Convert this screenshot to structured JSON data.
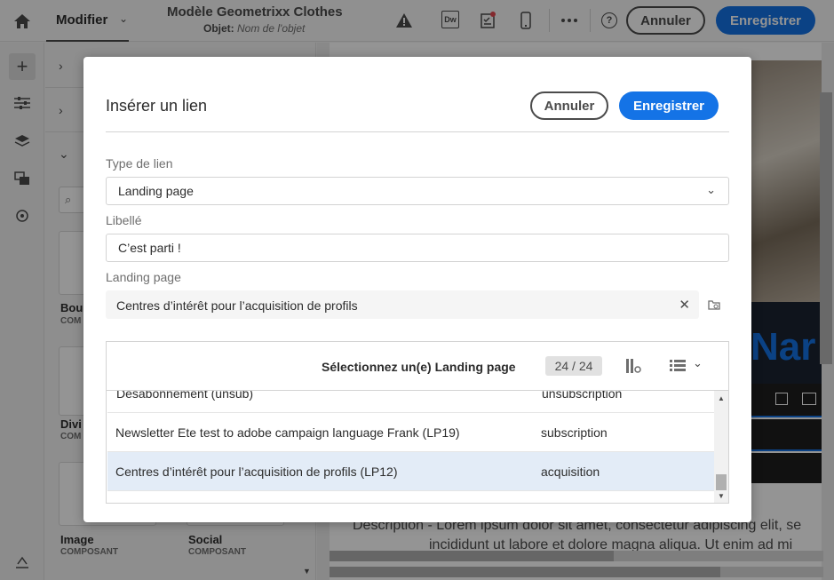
{
  "topbar": {
    "mode_label": "Modifier",
    "template_title": "Modèle Geometrixx Clothes",
    "subject_label": "Objet:",
    "subject_placeholder": "Nom de l'objet",
    "dw_icon_text": "Dw",
    "cancel_label": "Annuler",
    "save_label": "Enregistrer"
  },
  "left_panel": {
    "items": [
      {
        "title": "Bou",
        "sub": "COM"
      },
      {
        "title": "Divi",
        "sub": "COM"
      },
      {
        "title": "Image",
        "sub": "COMPOSANT"
      },
      {
        "title": "Social",
        "sub": "COMPOSANT"
      }
    ]
  },
  "canvas": {
    "title_fragment": "Nar",
    "description": "Description - Lorem ipsum dolor sit amet, consectetur adipiscing elit, se",
    "description_line2": "incididunt ut labore et dolore magna aliqua. Ut enim ad mi"
  },
  "dialog": {
    "title": "Insérer un lien",
    "cancel_label": "Annuler",
    "save_label": "Enregistrer",
    "link_type_label": "Type de lien",
    "link_type_value": "Landing page",
    "libelle_label": "Libellé",
    "libelle_value": "C’est parti !",
    "landing_label": "Landing page",
    "landing_value": "Centres d’intérêt pour l’acquisition de profils",
    "picker": {
      "title": "Sélectionnez un(e) Landing page",
      "count": "24 / 24",
      "rows": [
        {
          "name": "Désabonnement (unsub)",
          "type": "unsubscription"
        },
        {
          "name": "Newsletter Ete test to adobe campaign language Frank (LP19)",
          "type": "subscription"
        },
        {
          "name": "Centres d’intérêt pour l’acquisition de profils (LP12)",
          "type": "acquisition",
          "selected": true
        }
      ]
    }
  },
  "colors": {
    "primary": "#1473e6",
    "selected_row": "#e3ecf7"
  }
}
